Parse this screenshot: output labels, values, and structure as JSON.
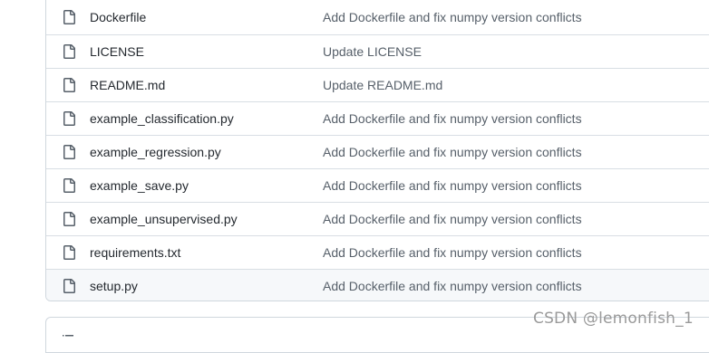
{
  "files": [
    {
      "name": "Dockerfile",
      "commit": "Add Dockerfile and fix numpy version conflicts"
    },
    {
      "name": "LICENSE",
      "commit": "Update LICENSE"
    },
    {
      "name": "README.md",
      "commit": "Update README.md"
    },
    {
      "name": "example_classification.py",
      "commit": "Add Dockerfile and fix numpy version conflicts"
    },
    {
      "name": "example_regression.py",
      "commit": "Add Dockerfile and fix numpy version conflicts"
    },
    {
      "name": "example_save.py",
      "commit": "Add Dockerfile and fix numpy version conflicts"
    },
    {
      "name": "example_unsupervised.py",
      "commit": "Add Dockerfile and fix numpy version conflicts"
    },
    {
      "name": "requirements.txt",
      "commit": "Add Dockerfile and fix numpy version conflicts"
    },
    {
      "name": "setup.py",
      "commit": "Add Dockerfile and fix numpy version conflicts"
    }
  ],
  "hovered_file": "setup.py",
  "icons": {
    "file": "file-icon",
    "list": "list-icon"
  },
  "colors": {
    "border": "#d0d7de",
    "icon": "#57606a",
    "hover_bg": "#f6f8fa"
  },
  "watermark": "CSDN @lemonfish_1"
}
